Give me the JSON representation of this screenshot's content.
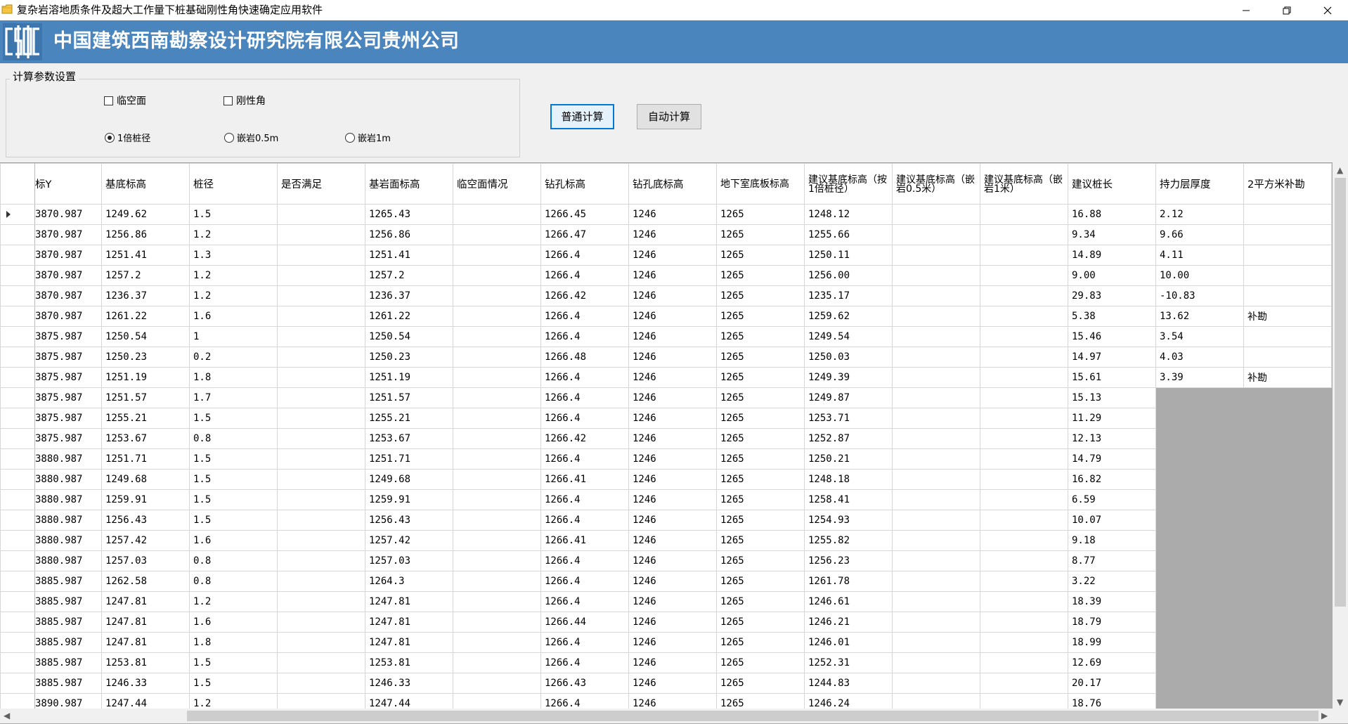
{
  "window": {
    "title": "复杂岩溶地质条件及超大工作量下桩基础刚性角快速确定应用软件"
  },
  "banner": {
    "company": "中国建筑西南勘察设计研究院有限公司贵州公司"
  },
  "settings": {
    "group_label": "计算参数设置",
    "checkbox_free_face": "临空面",
    "checkbox_rigid_angle": "刚性角",
    "radio_1d": "1倍桩径",
    "radio_05m": "嵌岩0.5m",
    "radio_1m": "嵌岩1m",
    "radio_selected": "1倍桩径",
    "btn_normal": "普通计算",
    "btn_auto": "自动计算"
  },
  "grid": {
    "columns": [
      "标Y",
      "基底标高",
      "桩径",
      "是否满足",
      "基岩面标高",
      "临空面情况",
      "钻孔标高",
      "钻孔底标高",
      "地下室底板标高",
      "建议基底标高（按1倍桩径）",
      "建议基底标高（嵌岩0.5米）",
      "建议基底标高（嵌岩1米）",
      "建议桩长",
      "持力层厚度",
      "2平方米补勘"
    ],
    "rows": [
      [
        "3870.987",
        "1249.62",
        "1.5",
        "",
        "1265.43",
        "",
        "1266.45",
        "1246",
        "1265",
        "1248.12",
        "",
        "",
        "16.88",
        "2.12",
        ""
      ],
      [
        "3870.987",
        "1256.86",
        "1.2",
        "",
        "1256.86",
        "",
        "1266.47",
        "1246",
        "1265",
        "1255.66",
        "",
        "",
        "9.34",
        "9.66",
        ""
      ],
      [
        "3870.987",
        "1251.41",
        "1.3",
        "",
        "1251.41",
        "",
        "1266.4",
        "1246",
        "1265",
        "1250.11",
        "",
        "",
        "14.89",
        "4.11",
        ""
      ],
      [
        "3870.987",
        "1257.2",
        "1.2",
        "",
        "1257.2",
        "",
        "1266.4",
        "1246",
        "1265",
        "1256.00",
        "",
        "",
        "9.00",
        "10.00",
        ""
      ],
      [
        "3870.987",
        "1236.37",
        "1.2",
        "",
        "1236.37",
        "",
        "1266.42",
        "1246",
        "1265",
        "1235.17",
        "",
        "",
        "29.83",
        "-10.83",
        ""
      ],
      [
        "3870.987",
        "1261.22",
        "1.6",
        "",
        "1261.22",
        "",
        "1266.4",
        "1246",
        "1265",
        "1259.62",
        "",
        "",
        "5.38",
        "13.62",
        "补勘"
      ],
      [
        "3875.987",
        "1250.54",
        "1",
        "",
        "1250.54",
        "",
        "1266.4",
        "1246",
        "1265",
        "1249.54",
        "",
        "",
        "15.46",
        "3.54",
        ""
      ],
      [
        "3875.987",
        "1250.23",
        "0.2",
        "",
        "1250.23",
        "",
        "1266.48",
        "1246",
        "1265",
        "1250.03",
        "",
        "",
        "14.97",
        "4.03",
        ""
      ],
      [
        "3875.987",
        "1251.19",
        "1.8",
        "",
        "1251.19",
        "",
        "1266.4",
        "1246",
        "1265",
        "1249.39",
        "",
        "",
        "15.61",
        "3.39",
        "补勘"
      ],
      [
        "3875.987",
        "1251.57",
        "1.7",
        "",
        "1251.57",
        "",
        "1266.4",
        "1246",
        "1265",
        "1249.87",
        "",
        "",
        "15.13",
        null,
        null
      ],
      [
        "3875.987",
        "1255.21",
        "1.5",
        "",
        "1255.21",
        "",
        "1266.4",
        "1246",
        "1265",
        "1253.71",
        "",
        "",
        "11.29",
        null,
        null
      ],
      [
        "3875.987",
        "1253.67",
        "0.8",
        "",
        "1253.67",
        "",
        "1266.42",
        "1246",
        "1265",
        "1252.87",
        "",
        "",
        "12.13",
        null,
        null
      ],
      [
        "3880.987",
        "1251.71",
        "1.5",
        "",
        "1251.71",
        "",
        "1266.4",
        "1246",
        "1265",
        "1250.21",
        "",
        "",
        "14.79",
        null,
        null
      ],
      [
        "3880.987",
        "1249.68",
        "1.5",
        "",
        "1249.68",
        "",
        "1266.41",
        "1246",
        "1265",
        "1248.18",
        "",
        "",
        "16.82",
        null,
        null
      ],
      [
        "3880.987",
        "1259.91",
        "1.5",
        "",
        "1259.91",
        "",
        "1266.4",
        "1246",
        "1265",
        "1258.41",
        "",
        "",
        "6.59",
        null,
        null
      ],
      [
        "3880.987",
        "1256.43",
        "1.5",
        "",
        "1256.43",
        "",
        "1266.4",
        "1246",
        "1265",
        "1254.93",
        "",
        "",
        "10.07",
        null,
        null
      ],
      [
        "3880.987",
        "1257.42",
        "1.6",
        "",
        "1257.42",
        "",
        "1266.41",
        "1246",
        "1265",
        "1255.82",
        "",
        "",
        "9.18",
        null,
        null
      ],
      [
        "3880.987",
        "1257.03",
        "0.8",
        "",
        "1257.03",
        "",
        "1266.4",
        "1246",
        "1265",
        "1256.23",
        "",
        "",
        "8.77",
        null,
        null
      ],
      [
        "3885.987",
        "1262.58",
        "0.8",
        "",
        "1264.3",
        "",
        "1266.4",
        "1246",
        "1265",
        "1261.78",
        "",
        "",
        "3.22",
        null,
        null
      ],
      [
        "3885.987",
        "1247.81",
        "1.2",
        "",
        "1247.81",
        "",
        "1266.4",
        "1246",
        "1265",
        "1246.61",
        "",
        "",
        "18.39",
        null,
        null
      ],
      [
        "3885.987",
        "1247.81",
        "1.6",
        "",
        "1247.81",
        "",
        "1266.44",
        "1246",
        "1265",
        "1246.21",
        "",
        "",
        "18.79",
        null,
        null
      ],
      [
        "3885.987",
        "1247.81",
        "1.8",
        "",
        "1247.81",
        "",
        "1266.4",
        "1246",
        "1265",
        "1246.01",
        "",
        "",
        "18.99",
        null,
        null
      ],
      [
        "3885.987",
        "1253.81",
        "1.5",
        "",
        "1253.81",
        "",
        "1266.4",
        "1246",
        "1265",
        "1252.31",
        "",
        "",
        "12.69",
        null,
        null
      ],
      [
        "3885.987",
        "1246.33",
        "1.5",
        "",
        "1246.33",
        "",
        "1266.43",
        "1246",
        "1265",
        "1244.83",
        "",
        "",
        "20.17",
        null,
        null
      ],
      [
        "3890.987",
        "1247.44",
        "1.2",
        "",
        "1247.44",
        "",
        "1266.4",
        "1246",
        "1265",
        "1246.24",
        "",
        "",
        "18.76",
        null,
        null
      ]
    ]
  },
  "colors": {
    "banner": "#4a85bd",
    "primary_button_border": "#0078d7",
    "empty_area": "#ababab"
  },
  "icons": [
    "app-folder-icon",
    "company-logo",
    "minimize-icon",
    "restore-icon",
    "close-icon",
    "row-pointer-icon",
    "scroll-up-icon",
    "scroll-down-icon",
    "scroll-left-icon",
    "scroll-right-icon"
  ]
}
